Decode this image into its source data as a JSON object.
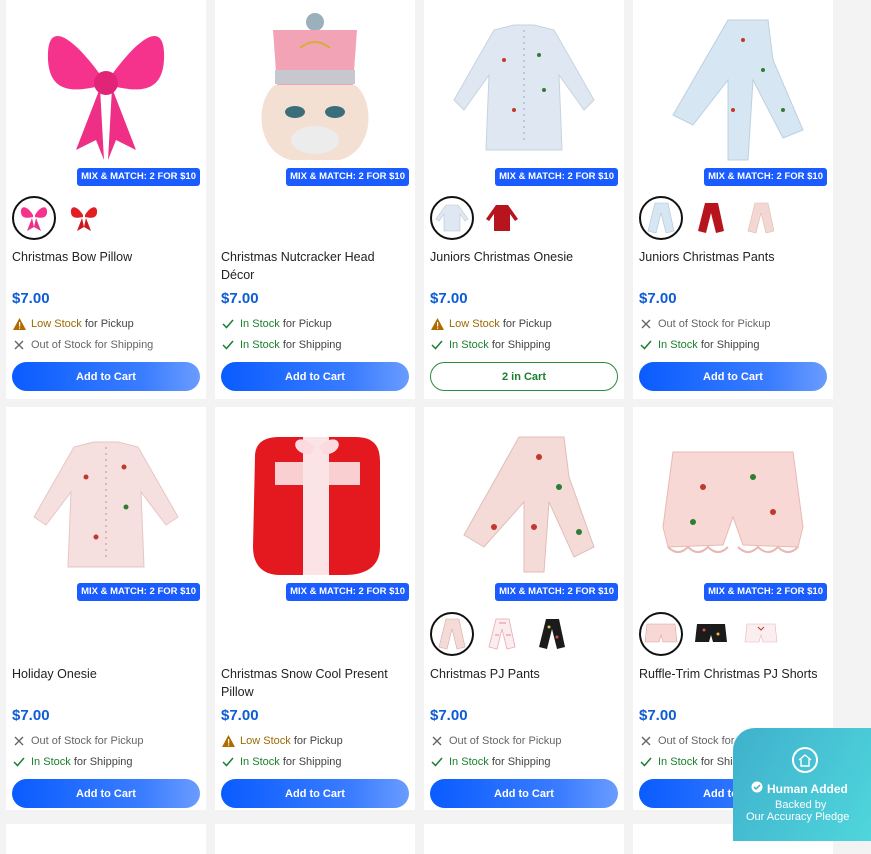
{
  "promo_badge": "MIX & MATCH: 2 FOR $10",
  "colors": {
    "accent": "#1a5cff",
    "in_stock": "#1a7f2e",
    "low_stock": "#9a6b00",
    "price": "#0d5cd6"
  },
  "products": [
    {
      "title": "Christmas Bow Pillow",
      "price": "$7.00",
      "pickup": {
        "status": "Low Stock",
        "suffix": "for Pickup"
      },
      "shipping": {
        "status": "Out of Stock",
        "suffix": "for Shipping"
      },
      "button": "Add to Cart"
    },
    {
      "title": "Christmas Nutcracker Head Décor",
      "price": "$7.00",
      "pickup": {
        "status": "In Stock",
        "suffix": "for Pickup"
      },
      "shipping": {
        "status": "In Stock",
        "suffix": "for Shipping"
      },
      "button": "Add to Cart"
    },
    {
      "title": "Juniors Christmas Onesie",
      "price": "$7.00",
      "pickup": {
        "status": "Low Stock",
        "suffix": "for Pickup"
      },
      "shipping": {
        "status": "In Stock",
        "suffix": "for Shipping"
      },
      "button": "2 in Cart"
    },
    {
      "title": "Juniors Christmas Pants",
      "price": "$7.00",
      "pickup": {
        "status": "Out of Stock",
        "suffix": "for Pickup"
      },
      "shipping": {
        "status": "In Stock",
        "suffix": "for Shipping"
      },
      "button": "Add to Cart"
    },
    {
      "title": "Holiday Onesie",
      "price": "$7.00",
      "pickup": {
        "status": "Out of Stock",
        "suffix": "for Pickup"
      },
      "shipping": {
        "status": "In Stock",
        "suffix": "for Shipping"
      },
      "button": "Add to Cart"
    },
    {
      "title": "Christmas Snow Cool Present Pillow",
      "price": "$7.00",
      "pickup": {
        "status": "Low Stock",
        "suffix": "for Pickup"
      },
      "shipping": {
        "status": "In Stock",
        "suffix": "for Shipping"
      },
      "button": "Add to Cart"
    },
    {
      "title": "Christmas PJ Pants",
      "price": "$7.00",
      "pickup": {
        "status": "Out of Stock",
        "suffix": "for Pickup"
      },
      "shipping": {
        "status": "In Stock",
        "suffix": "for Shipping"
      },
      "button": "Add to Cart"
    },
    {
      "title": "Ruffle-Trim Christmas PJ Shorts",
      "price": "$7.00",
      "pickup": {
        "status": "Out of Stock",
        "suffix": "for Pickup"
      },
      "shipping": {
        "status": "In Stock",
        "suffix": "for Shipping"
      },
      "button": "Add to Cart"
    }
  ],
  "pledge": {
    "title": "Human Added",
    "line1": "Backed by",
    "line2": "Our Accuracy Pledge"
  }
}
